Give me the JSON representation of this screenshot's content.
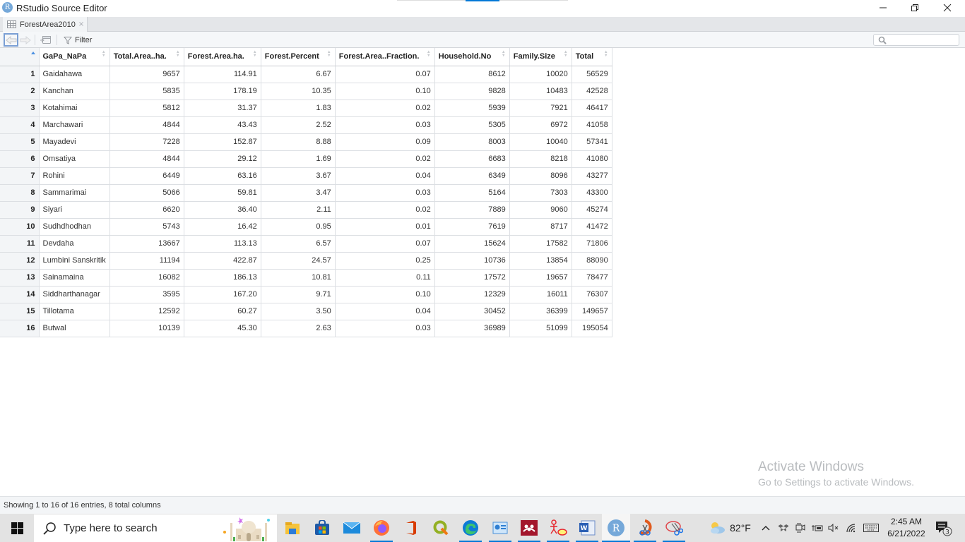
{
  "window": {
    "title": "RStudio Source Editor",
    "app_icon_letter": "R"
  },
  "tab": {
    "label": "ForestArea2010",
    "close_glyph": "×"
  },
  "toolbar": {
    "filter_label": "Filter",
    "search_placeholder": ""
  },
  "table": {
    "columns": [
      "GaPa_NaPa",
      "Total.Area..ha.",
      "Forest.Area.ha.",
      "Forest.Percent",
      "Forest.Area..Fraction.",
      "Household.No",
      "Family.Size",
      "Total"
    ],
    "rows": [
      {
        "n": "1",
        "cells": [
          "Gaidahawa",
          "9657",
          "114.91",
          "6.67",
          "0.07",
          "8612",
          "10020",
          "56529"
        ]
      },
      {
        "n": "2",
        "cells": [
          "Kanchan",
          "5835",
          "178.19",
          "10.35",
          "0.10",
          "9828",
          "10483",
          "42528"
        ]
      },
      {
        "n": "3",
        "cells": [
          "Kotahimai",
          "5812",
          "31.37",
          "1.83",
          "0.02",
          "5939",
          "7921",
          "46417"
        ]
      },
      {
        "n": "4",
        "cells": [
          "Marchawari",
          "4844",
          "43.43",
          "2.52",
          "0.03",
          "5305",
          "6972",
          "41058"
        ]
      },
      {
        "n": "5",
        "cells": [
          "Mayadevi",
          "7228",
          "152.87",
          "8.88",
          "0.09",
          "8003",
          "10040",
          "57341"
        ]
      },
      {
        "n": "6",
        "cells": [
          "Omsatiya",
          "4844",
          "29.12",
          "1.69",
          "0.02",
          "6683",
          "8218",
          "41080"
        ]
      },
      {
        "n": "7",
        "cells": [
          "Rohini",
          "6449",
          "63.16",
          "3.67",
          "0.04",
          "6349",
          "8096",
          "43277"
        ]
      },
      {
        "n": "8",
        "cells": [
          "Sammarimai",
          "5066",
          "59.81",
          "3.47",
          "0.03",
          "5164",
          "7303",
          "43300"
        ]
      },
      {
        "n": "9",
        "cells": [
          "Siyari",
          "6620",
          "36.40",
          "2.11",
          "0.02",
          "7889",
          "9060",
          "45274"
        ]
      },
      {
        "n": "10",
        "cells": [
          "Sudhdhodhan",
          "5743",
          "16.42",
          "0.95",
          "0.01",
          "7619",
          "8717",
          "41472"
        ]
      },
      {
        "n": "11",
        "cells": [
          "Devdaha",
          "13667",
          "113.13",
          "6.57",
          "0.07",
          "15624",
          "17582",
          "71806"
        ]
      },
      {
        "n": "12",
        "cells": [
          "Lumbini Sanskritik",
          "11194",
          "422.87",
          "24.57",
          "0.25",
          "10736",
          "13854",
          "88090"
        ]
      },
      {
        "n": "13",
        "cells": [
          "Sainamaina",
          "16082",
          "186.13",
          "10.81",
          "0.11",
          "17572",
          "19657",
          "78477"
        ]
      },
      {
        "n": "14",
        "cells": [
          "Siddharthanagar",
          "3595",
          "167.20",
          "9.71",
          "0.10",
          "12329",
          "16011",
          "76307"
        ]
      },
      {
        "n": "15",
        "cells": [
          "Tillotama",
          "12592",
          "60.27",
          "3.50",
          "0.04",
          "30452",
          "36399",
          "149657"
        ]
      },
      {
        "n": "16",
        "cells": [
          "Butwal",
          "10139",
          "45.30",
          "2.63",
          "0.03",
          "36989",
          "51099",
          "195054"
        ]
      }
    ]
  },
  "status": {
    "text": "Showing 1 to 16 of 16 entries, 8 total columns"
  },
  "watermark": {
    "line1": "Activate Windows",
    "line2": "Go to Settings to activate Windows."
  },
  "taskbar": {
    "search_placeholder": "Type here to search",
    "apps": [
      {
        "name": "file-explorer",
        "running": false
      },
      {
        "name": "microsoft-store",
        "running": false
      },
      {
        "name": "mail",
        "running": false
      },
      {
        "name": "firefox",
        "running": true
      },
      {
        "name": "office",
        "running": false
      },
      {
        "name": "qgis",
        "running": false
      },
      {
        "name": "edge",
        "running": true
      },
      {
        "name": "control-panel",
        "running": true
      },
      {
        "name": "mendeley",
        "running": true
      },
      {
        "name": "uml-tool",
        "running": true
      },
      {
        "name": "word",
        "running": true
      },
      {
        "name": "rstudio",
        "running": true
      },
      {
        "name": "snip-sketch",
        "running": true
      },
      {
        "name": "snipping-tool",
        "running": true
      }
    ],
    "weather_temp": "82°F",
    "clock_time": "2:45 AM",
    "clock_date": "6/21/2022",
    "notification_count": "3"
  },
  "colors": {
    "accent": "#0078d7",
    "sort_active": "#4a90e2",
    "rownum_bg": "#f3f5f7"
  }
}
